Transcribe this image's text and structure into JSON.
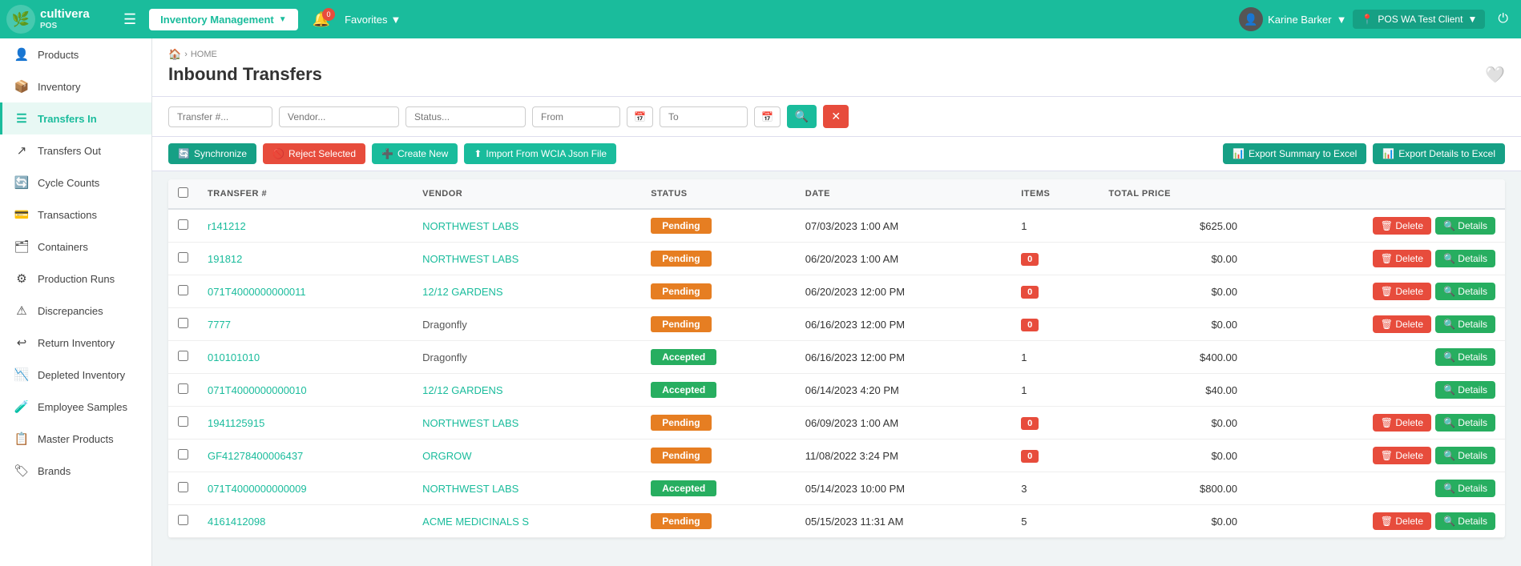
{
  "app": {
    "brand": "cultivera",
    "sub": "POS",
    "user": "Karine Barker",
    "location": "POS WA Test Client",
    "notification_count": "0"
  },
  "nav": {
    "module_label": "Inventory Management",
    "favorites_label": "Favorites"
  },
  "sidebar": {
    "items": [
      {
        "id": "products",
        "label": "Products",
        "icon": "👤"
      },
      {
        "id": "inventory",
        "label": "Inventory",
        "icon": "📦"
      },
      {
        "id": "transfers-in",
        "label": "Transfers In",
        "icon": "☰",
        "active": true
      },
      {
        "id": "transfers-out",
        "label": "Transfers Out",
        "icon": "↗"
      },
      {
        "id": "cycle-counts",
        "label": "Cycle Counts",
        "icon": "🔄"
      },
      {
        "id": "transactions",
        "label": "Transactions",
        "icon": "💳"
      },
      {
        "id": "containers",
        "label": "Containers",
        "icon": "🗂"
      },
      {
        "id": "production-runs",
        "label": "Production Runs",
        "icon": "⚙"
      },
      {
        "id": "discrepancies",
        "label": "Discrepancies",
        "icon": "⚠"
      },
      {
        "id": "return-inventory",
        "label": "Return Inventory",
        "icon": "↩"
      },
      {
        "id": "depleted-inventory",
        "label": "Depleted Inventory",
        "icon": "📉"
      },
      {
        "id": "employee-samples",
        "label": "Employee Samples",
        "icon": "🧪"
      },
      {
        "id": "master-products",
        "label": "Master Products",
        "icon": "📋"
      },
      {
        "id": "brands",
        "label": "Brands",
        "icon": "🏷"
      }
    ]
  },
  "breadcrumb": {
    "home_icon": "🏠",
    "home_label": "HOME"
  },
  "page": {
    "title": "Inbound Transfers"
  },
  "filters": {
    "transfer_placeholder": "Transfer #...",
    "vendor_placeholder": "Vendor...",
    "status_placeholder": "Status...",
    "from_placeholder": "From",
    "to_placeholder": "To"
  },
  "actions": {
    "sync": "Synchronize",
    "reject": "Reject Selected",
    "create": "Create New",
    "import": "Import From WCIA Json File",
    "export_summary": "Export Summary to Excel",
    "export_details": "Export Details to Excel"
  },
  "table": {
    "columns": [
      "",
      "TRANSFER #",
      "VENDOR",
      "STATUS",
      "DATE",
      "ITEMS",
      "TOTAL PRICE",
      ""
    ],
    "rows": [
      {
        "id": "r141212",
        "vendor": "NORTHWEST LABS",
        "vendor_color": "teal",
        "status": "Pending",
        "status_type": "pending",
        "date": "07/03/2023 1:00 AM",
        "items": 1,
        "items_badge": false,
        "total": "$625.00",
        "has_delete": true
      },
      {
        "id": "191812",
        "vendor": "NORTHWEST LABS",
        "vendor_color": "teal",
        "status": "Pending",
        "status_type": "pending",
        "date": "06/20/2023 1:00 AM",
        "items": 0,
        "items_badge": true,
        "total": "$0.00",
        "has_delete": true
      },
      {
        "id": "071T4000000000011",
        "vendor": "12/12 GARDENS",
        "vendor_color": "teal",
        "status": "Pending",
        "status_type": "pending",
        "date": "06/20/2023 12:00 PM",
        "items": 0,
        "items_badge": true,
        "total": "$0.00",
        "has_delete": true
      },
      {
        "id": "7777",
        "vendor": "Dragonfly",
        "vendor_color": "default",
        "status": "Pending",
        "status_type": "pending",
        "date": "06/16/2023 12:00 PM",
        "items": 0,
        "items_badge": true,
        "total": "$0.00",
        "has_delete": true
      },
      {
        "id": "010101010",
        "vendor": "Dragonfly",
        "vendor_color": "default",
        "status": "Accepted",
        "status_type": "accepted",
        "date": "06/16/2023 12:00 PM",
        "items": 1,
        "items_badge": false,
        "total": "$400.00",
        "has_delete": false
      },
      {
        "id": "071T4000000000010",
        "vendor": "12/12 GARDENS",
        "vendor_color": "teal",
        "status": "Accepted",
        "status_type": "accepted",
        "date": "06/14/2023 4:20 PM",
        "items": 1,
        "items_badge": false,
        "total": "$40.00",
        "has_delete": false
      },
      {
        "id": "1941125915",
        "vendor": "NORTHWEST LABS",
        "vendor_color": "teal",
        "status": "Pending",
        "status_type": "pending",
        "date": "06/09/2023 1:00 AM",
        "items": 0,
        "items_badge": true,
        "total": "$0.00",
        "has_delete": true
      },
      {
        "id": "GF41278400006437",
        "vendor": "ORGROW",
        "vendor_color": "teal",
        "status": "Pending",
        "status_type": "pending",
        "date": "11/08/2022 3:24 PM",
        "items": 0,
        "items_badge": true,
        "total": "$0.00",
        "has_delete": true
      },
      {
        "id": "071T4000000000009",
        "vendor": "NORTHWEST LABS",
        "vendor_color": "teal",
        "status": "Accepted",
        "status_type": "accepted",
        "date": "05/14/2023 10:00 PM",
        "items": 3,
        "items_badge": false,
        "total": "$800.00",
        "has_delete": false
      },
      {
        "id": "4161412098",
        "vendor": "ACME MEDICINALS S",
        "vendor_color": "teal",
        "status": "Pending",
        "status_type": "pending",
        "date": "05/15/2023 11:31 AM",
        "items": 5,
        "items_badge": false,
        "total": "$0.00",
        "has_delete": true
      }
    ]
  }
}
